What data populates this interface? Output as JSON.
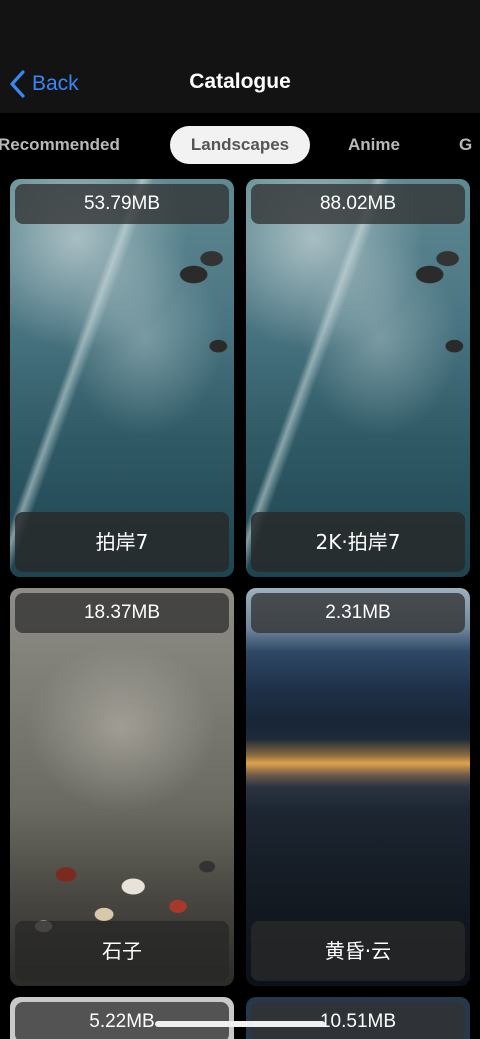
{
  "nav": {
    "back_label": "Back",
    "title": "Catalogue"
  },
  "tabs": [
    {
      "label": "Recommended",
      "active": false
    },
    {
      "label": "Landscapes",
      "active": true
    },
    {
      "label": "Anime",
      "active": false
    },
    {
      "label": "G",
      "active": false
    }
  ],
  "wallpapers": [
    {
      "size": "53.79MB",
      "name": "拍岸7",
      "image": "ocean-waves"
    },
    {
      "size": "88.02MB",
      "name": "2K·拍岸7",
      "image": "ocean-waves"
    },
    {
      "size": "18.37MB",
      "name": "石子",
      "image": "pebbles"
    },
    {
      "size": "2.31MB",
      "name": "黄昏·云",
      "image": "sunset-clouds"
    },
    {
      "size": "5.22MB",
      "name": "",
      "image": "unknown"
    },
    {
      "size": "10.51MB",
      "name": "",
      "image": "unknown"
    }
  ],
  "colors": {
    "accent": "#3a86f5",
    "nav_background": "#131313",
    "background": "#000000",
    "active_tab_bg": "#f2f2f2"
  }
}
